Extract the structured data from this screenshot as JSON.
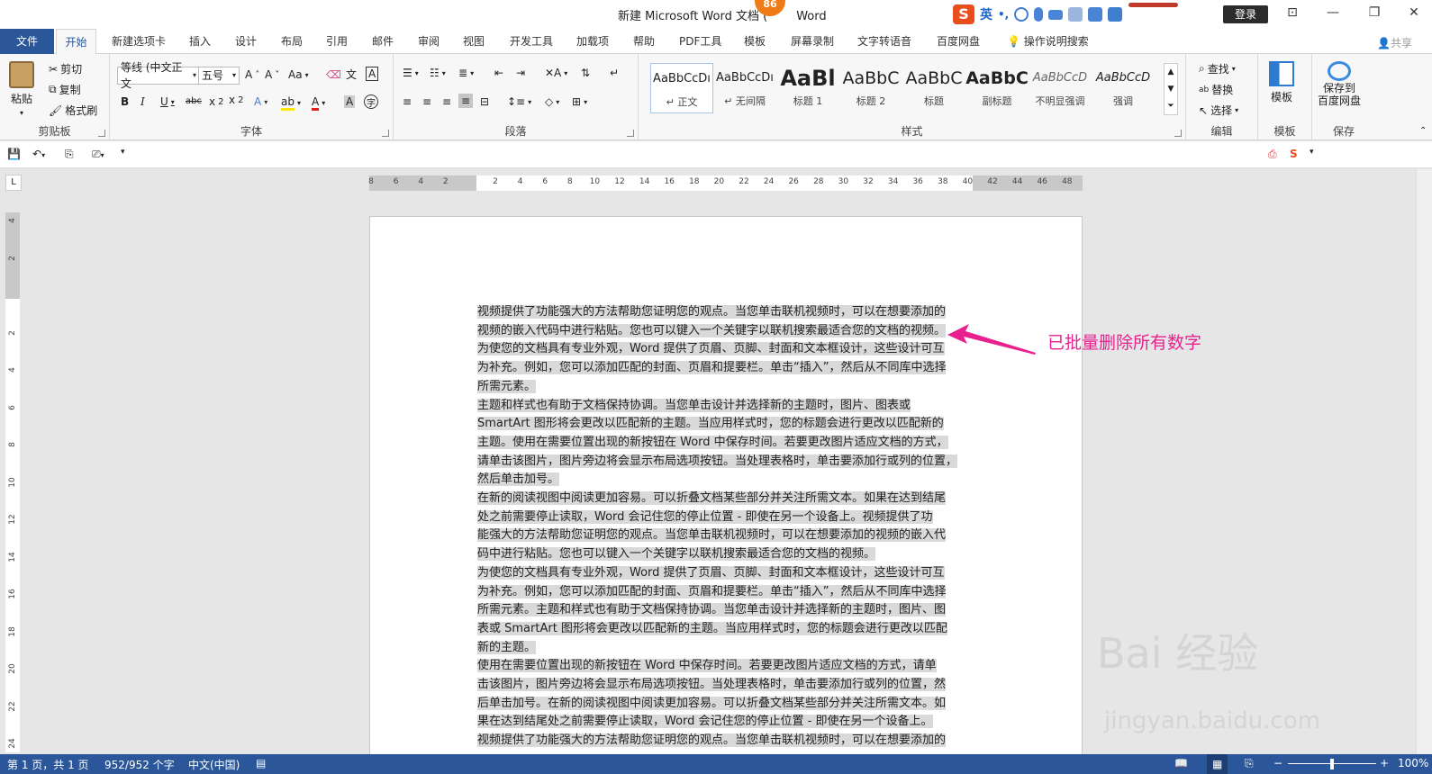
{
  "window": {
    "title": "新建 Microsoft Word 文档 (",
    "title_suffix": "Word",
    "badge": "86",
    "login": "登录",
    "ime_label": "英"
  },
  "tabs": [
    "文件",
    "开始",
    "新建选项卡",
    "插入",
    "设计",
    "布局",
    "引用",
    "邮件",
    "审阅",
    "视图",
    "开发工具",
    "加载项",
    "帮助",
    "PDF工具",
    "模板",
    "屏幕录制",
    "文字转语音",
    "百度网盘",
    "操作说明搜索"
  ],
  "active_tab": "开始",
  "share": "共享",
  "clipboard": {
    "paste": "粘贴",
    "cut": "剪切",
    "copy": "复制",
    "format_painter": "格式刷",
    "label": "剪贴板"
  },
  "font": {
    "family": "等线 (中文正文",
    "size": "五号",
    "label": "字体",
    "aa": "Aa"
  },
  "paragraph": {
    "label": "段落"
  },
  "styles": {
    "label": "样式",
    "items": [
      {
        "sample": "AaBbCcDı",
        "name": "↵ 正文"
      },
      {
        "sample": "AaBbCcDı",
        "name": "↵ 无间隔"
      },
      {
        "sample": "AaBl",
        "name": "标题 1"
      },
      {
        "sample": "AaBbC",
        "name": "标题 2"
      },
      {
        "sample": "AaBbC",
        "name": "标题"
      },
      {
        "sample": "AaBbC",
        "name": "副标题"
      },
      {
        "sample": "AaBbCcD",
        "name": "不明显强调"
      },
      {
        "sample": "AaBbCcD",
        "name": "强调"
      }
    ]
  },
  "editing": {
    "find": "查找",
    "replace": "替换",
    "select": "选择",
    "label": "编辑"
  },
  "template": {
    "button": "模板",
    "label": "模板"
  },
  "save": {
    "button": "保存到\n百度网盘",
    "label": "保存"
  },
  "ruler": {
    "h_ticks": [
      "8",
      "6",
      "4",
      "2",
      "",
      "2",
      "4",
      "6",
      "8",
      "10",
      "12",
      "14",
      "16",
      "18",
      "20",
      "22",
      "24",
      "26",
      "28",
      "30",
      "32",
      "34",
      "36",
      "38",
      "40",
      "42",
      "44",
      "46",
      "48"
    ],
    "v_ticks": [
      "4",
      "2",
      "",
      "2",
      "4",
      "6",
      "8",
      "10",
      "12",
      "14",
      "16",
      "18",
      "20",
      "22",
      "24"
    ]
  },
  "document": {
    "paragraphs": [
      [
        "视频提供了功能强大的方法帮助您证明您的观点。当您单击联机视频时，可以在想要添加的",
        "视频的嵌入代码中进行粘贴。您也可以键入一个关键字以联机搜索最适合您的文档的视频。",
        "为使您的文档具有专业外观，Word 提供了页眉、页脚、封面和文本框设计，这些设计可互",
        "为补充。例如，您可以添加匹配的封面、页眉和提要栏。单击“插入”，然后从不同库中选择",
        "所需元素。"
      ],
      [
        "主题和样式也有助于文档保持协调。当您单击设计并选择新的主题时，图片、图表或",
        "SmartArt 图形将会更改以匹配新的主题。当应用样式时，您的标题会进行更改以匹配新的",
        "主题。使用在需要位置出现的新按钮在 Word 中保存时间。若要更改图片适应文档的方式，",
        "请单击该图片，图片旁边将会显示布局选项按钮。当处理表格时，单击要添加行或列的位置，",
        "然后单击加号。"
      ],
      [
        "在新的阅读视图中阅读更加容易。可以折叠文档某些部分并关注所需文本。如果在达到结尾",
        "处之前需要停止读取，Word 会记住您的停止位置 - 即使在另一个设备上。视频提供了功",
        "能强大的方法帮助您证明您的观点。当您单击联机视频时，可以在想要添加的视频的嵌入代",
        "码中进行粘贴。您也可以键入一个关键字以联机搜索最适合您的文档的视频。"
      ],
      [
        "为使您的文档具有专业外观，Word 提供了页眉、页脚、封面和文本框设计，这些设计可互",
        "为补充。例如，您可以添加匹配的封面、页眉和提要栏。单击“插入”，然后从不同库中选择",
        "所需元素。主题和样式也有助于文档保持协调。当您单击设计并选择新的主题时，图片、图",
        "表或 SmartArt 图形将会更改以匹配新的主题。当应用样式时，您的标题会进行更改以匹配",
        "新的主题。"
      ],
      [
        "使用在需要位置出现的新按钮在 Word 中保存时间。若要更改图片适应文档的方式，请单",
        "击该图片，图片旁边将会显示布局选项按钮。当处理表格时，单击要添加行或列的位置，然",
        "后单击加号。在新的阅读视图中阅读更加容易。可以折叠文档某些部分并关注所需文本。如",
        "果在达到结尾处之前需要停止读取，Word 会记住您的停止位置 - 即使在另一个设备上。",
        "视频提供了功能强大的方法帮助您证明您的观点。当您单击联机视频时，可以在想要添加的"
      ]
    ]
  },
  "annotation": {
    "text": "已批量删除所有数字",
    "color": "#e8218e"
  },
  "watermark": {
    "main": "Bai  经验",
    "sub": "jingyan.baidu.com"
  },
  "statusbar": {
    "page": "第 1 页，共 1 页",
    "words": "952/952 个字",
    "language": "中文(中国)",
    "zoom": "100%",
    "zoom_percent": 100
  },
  "colors": {
    "accent": "#2b579a",
    "highlight": "#d9d9d9"
  }
}
